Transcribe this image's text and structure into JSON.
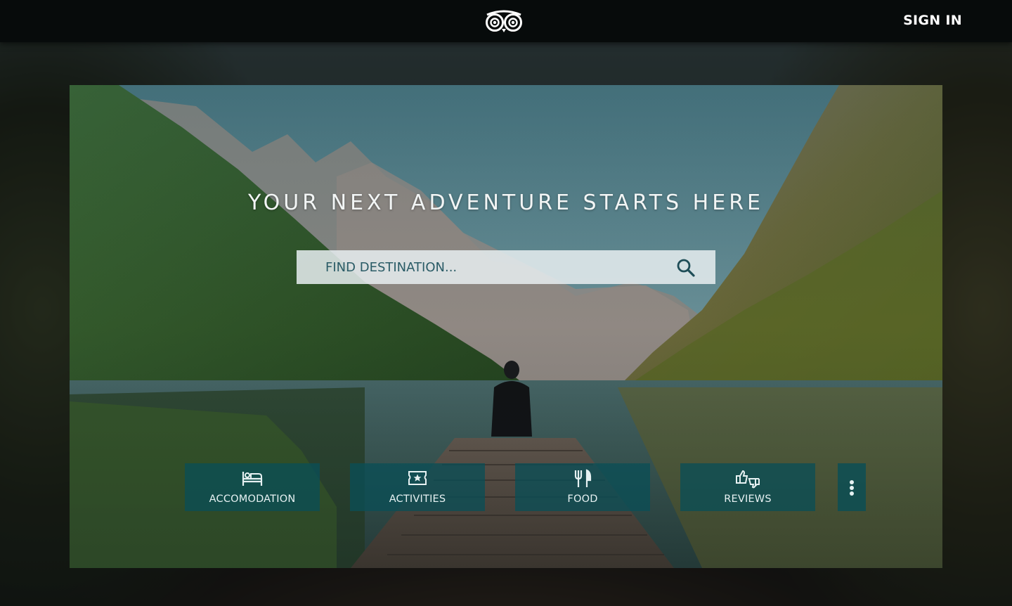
{
  "header": {
    "logo_icon": "tripadvisor-owl-logo-icon",
    "signin_label": "SIGN IN"
  },
  "hero": {
    "title": "YOUR NEXT ADVENTURE STARTS HERE",
    "search": {
      "placeholder": "FIND DESTINATION...",
      "value": "",
      "button_icon": "search-icon"
    },
    "categories": [
      {
        "label": "ACCOMODATION",
        "icon": "bed-icon"
      },
      {
        "label": "ACTIVITIES",
        "icon": "ticket-star-icon"
      },
      {
        "label": "FOOD",
        "icon": "fork-knife-icon"
      },
      {
        "label": "REVIEWS",
        "icon": "thumbs-up-down-icon"
      }
    ],
    "more_icon": "more-vertical-icon"
  },
  "colors": {
    "topbar": "#070b0b",
    "button_bg": "#0a4e56",
    "search_text": "#2a5b66",
    "text_light": "#f2f5f5"
  }
}
